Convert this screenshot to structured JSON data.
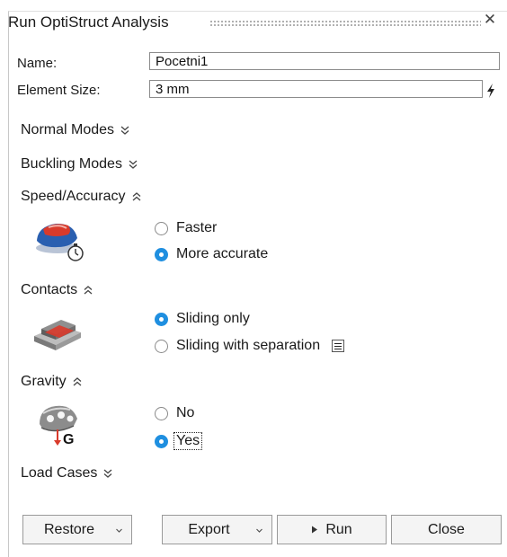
{
  "dialog": {
    "title": "Run OptiStruct Analysis",
    "close_icon": "close-icon"
  },
  "fields": {
    "name_label": "Name:",
    "name_value": "Pocetni1",
    "element_size_label": "Element Size:",
    "element_size_value": "3 mm",
    "element_size_icon": "lightning-bolt-icon"
  },
  "sections": {
    "normal_modes": {
      "label": "Normal Modes",
      "expanded": false
    },
    "buckling_modes": {
      "label": "Buckling Modes",
      "expanded": false
    },
    "speed_accuracy": {
      "label": "Speed/Accuracy",
      "expanded": true,
      "options": [
        "Faster",
        "More accurate"
      ],
      "selected": "More accurate",
      "icon": "car-model-stopwatch-icon"
    },
    "contacts": {
      "label": "Contacts",
      "expanded": true,
      "options": [
        "Sliding only",
        "Sliding with separation"
      ],
      "selected": "Sliding only",
      "icon": "sliding-contact-icon"
    },
    "gravity": {
      "label": "Gravity",
      "expanded": true,
      "options": [
        "No",
        "Yes"
      ],
      "selected": "Yes",
      "icon": "gravity-part-icon",
      "icon_letter": "G"
    },
    "load_cases": {
      "label": "Load Cases",
      "expanded": false
    }
  },
  "footer": {
    "restore": "Restore",
    "export": "Export",
    "run": "Run",
    "close": "Close"
  },
  "colors": {
    "accent": "#1f8fe0",
    "highlight_red": "#d93a2b",
    "model_blue": "#2a5fb0"
  }
}
